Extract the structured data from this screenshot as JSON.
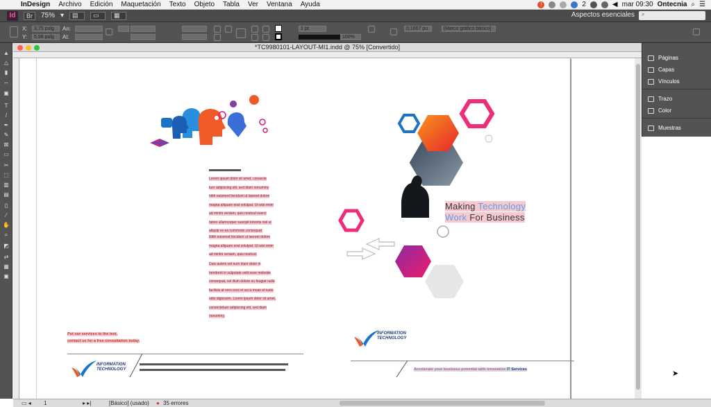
{
  "menubar": {
    "app": "InDesign",
    "items": [
      "Archivo",
      "Edición",
      "Maquetación",
      "Texto",
      "Objeto",
      "Tabla",
      "Ver",
      "Ventana",
      "Ayuda"
    ],
    "status_badge": "2",
    "time": "mar 09:30",
    "user": "Ontecnia"
  },
  "appbar": {
    "logo": "Id",
    "bridge": "Br",
    "zoom": "75%",
    "workspace": "Aspectos esenciales",
    "search_placeholder": ""
  },
  "control": {
    "x_label": "X:",
    "y_label": "Y:",
    "x_value": "3,75 pulg",
    "y_value": "5,98 pulg",
    "w_label": "An:",
    "h_label": "Al:",
    "stroke_weight": "1 pt",
    "percent": "100%",
    "gap": "0,1667 pu",
    "frame_style": "[Marco gráfico básico]"
  },
  "document": {
    "title": "*TC9980101-LAYOUT-MI1.indd @ 75% [Convertido]"
  },
  "panels": {
    "items": [
      "Páginas",
      "Capas",
      "Vínculos",
      "Trazo",
      "Color",
      "Muestras"
    ]
  },
  "statusbar": {
    "page": "1",
    "style": "[Básico] (usado)",
    "errors": "35 errores"
  },
  "spread": {
    "left": {
      "lorem_1": [
        "Lorem ipsum dolor sit amet, consecte",
        "tuer adipiscing elit, sed diam nonummy",
        "nibh euismod tincidunt ut laoreet dolore",
        "magna aliquam erat volutpat. Ut wisi enim",
        "ad minim veniam, quis nostrud exerci",
        "tation ullamcorper suscipit lobortis nisl ut",
        "aliquip ex ea commodo consequat."
      ],
      "lorem_2": [
        "Nibh euismod tincidunt ut laoreet dolore",
        "magna aliquam erat volutpat. Ut wisi enim",
        "ad minim veniam, quis nostrud."
      ],
      "lorem_3": [
        "Duis autem vel eum iriure dolor in",
        "hendrerit in vulputate velit esse molestie",
        "consequat, vel illum dolore eu feugiat nulla",
        "facilisis at vero eros et accu msan et iusto",
        "odio dignissim. Lorem ipsum dolor sit amet,",
        "consectetuer adipiscing elit, sed diam",
        "nonummy."
      ],
      "promo_line1": "Put our services to the test,",
      "promo_line2": "contact us for a free consultation today.",
      "logo_line1": "INFORMATION",
      "logo_line2": "TECHNOLOGY"
    },
    "right": {
      "headline_1a": "Making ",
      "headline_1b": "Technology",
      "headline_2a": "Work",
      "headline_2b": " For Business",
      "logo_line1": "INFORMATION",
      "logo_line2": "TECHNOLOGY",
      "tagline_a": "Accelerate your business potential with innovative ",
      "tagline_b": "IT Services"
    }
  },
  "colors": {
    "orange": "#f05a28",
    "magenta": "#d6187a",
    "blue": "#1c73c6",
    "pink_highlight": "#f6c9d1"
  }
}
